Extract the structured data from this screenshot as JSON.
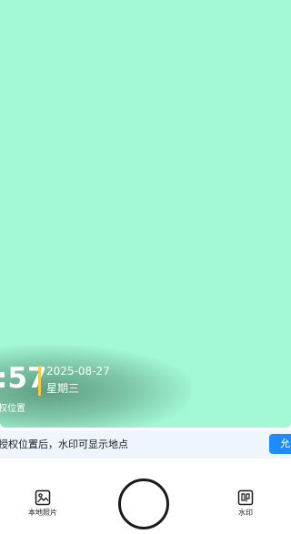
{
  "watermark": {
    "time": ":57",
    "date": "2025-08-27",
    "weekday": "星期三",
    "location_hint": "权位置",
    "accent_color": "#f7c948"
  },
  "notice": {
    "text": "授权位置后，水印可显示地点",
    "button_label": "允"
  },
  "toolbar": {
    "local_photos_label": "本地照片",
    "watermark_label": "水印"
  },
  "colors": {
    "viewfinder": "#a3f9d6",
    "notice_bg": "#eef5fd",
    "primary": "#1f8bff"
  },
  "icons": {
    "local_photos": "image-icon",
    "watermark": "stamp-icon",
    "shutter": "shutter-button"
  }
}
